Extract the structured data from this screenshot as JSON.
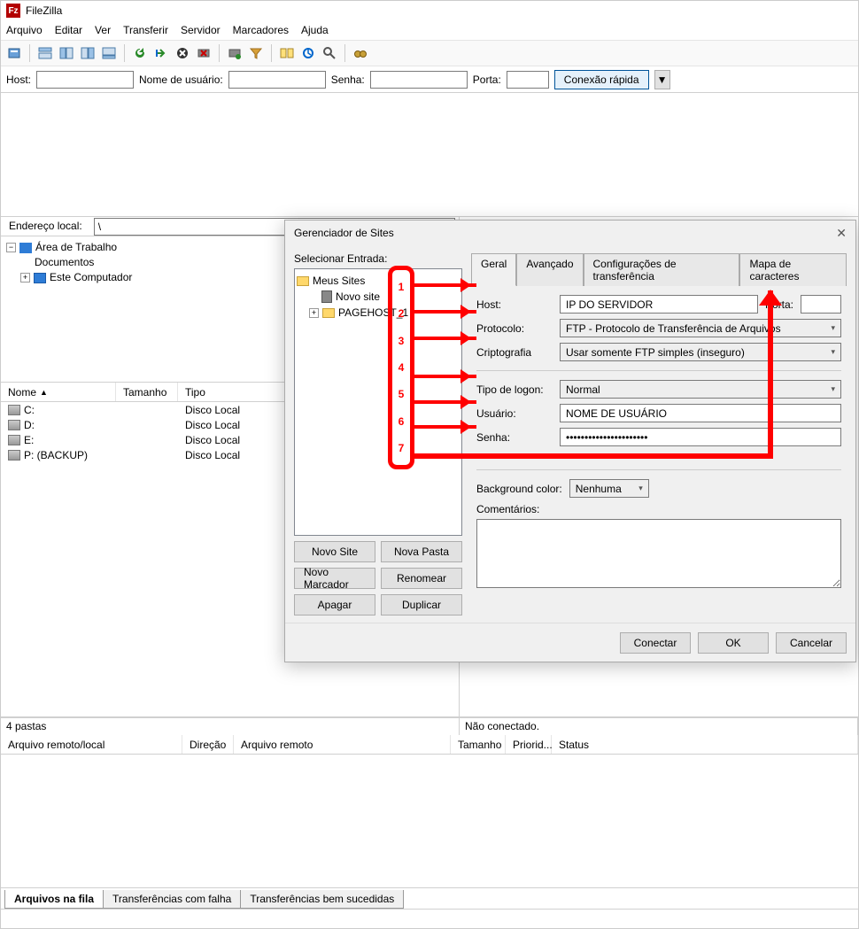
{
  "app": {
    "title": "FileZilla"
  },
  "menu": [
    "Arquivo",
    "Editar",
    "Ver",
    "Transferir",
    "Servidor",
    "Marcadores",
    "Ajuda"
  ],
  "quickbar": {
    "host_label": "Host:",
    "user_label": "Nome de usuário:",
    "pass_label": "Senha:",
    "port_label": "Porta:",
    "connect_label": "Conexão rápida"
  },
  "localaddr": {
    "label": "Endereço local:",
    "value": "\\"
  },
  "localtree": {
    "desktop": "Área de Trabalho",
    "documents": "Documentos",
    "computer": "Este Computador"
  },
  "localcols": {
    "name": "Nome",
    "size": "Tamanho",
    "type": "Tipo"
  },
  "drives": [
    {
      "name": "C:",
      "type": "Disco Local"
    },
    {
      "name": "D:",
      "type": "Disco Local"
    },
    {
      "name": "E:",
      "type": "Disco Local"
    },
    {
      "name": "P: (BACKUP)",
      "type": "Disco Local"
    }
  ],
  "status": {
    "left": "4 pastas",
    "right": "Não conectado."
  },
  "queuecols": [
    "Arquivo remoto/local",
    "Direção",
    "Arquivo remoto",
    "Tamanho",
    "Priorid...",
    "Status"
  ],
  "bottomtabs": [
    "Arquivos na fila",
    "Transferências com falha",
    "Transferências bem sucedidas"
  ],
  "dialog": {
    "title": "Gerenciador de Sites",
    "select_label": "Selecionar Entrada:",
    "tree": {
      "root": "Meus Sites",
      "novo": "Novo site",
      "page": "PAGEHOST_1"
    },
    "btns": {
      "novo_site": "Novo Site",
      "nova_pasta": "Nova Pasta",
      "novo_marcador": "Novo Marcador",
      "renomear": "Renomear",
      "apagar": "Apagar",
      "duplicar": "Duplicar"
    },
    "tabs": [
      "Geral",
      "Avançado",
      "Configurações de transferência",
      "Mapa de caracteres"
    ],
    "form": {
      "host_l": "Host:",
      "host_v": "IP DO SERVIDOR",
      "port_l": "Porta:",
      "proto_l": "Protocolo:",
      "proto_v": "FTP - Protocolo de Transferência de Arquivos",
      "cript_l": "Criptografia",
      "cript_v": "Usar somente FTP simples (inseguro)",
      "logon_l": "Tipo de logon:",
      "logon_v": "Normal",
      "user_l": "Usuário:",
      "user_v": "NOME DE USUÁRIO",
      "senha_l": "Senha:",
      "senha_v": "••••••••••••••••••••••",
      "bg_l": "Background color:",
      "bg_v": "Nenhuma",
      "comment_l": "Comentários:"
    },
    "footer": {
      "conectar": "Conectar",
      "ok": "OK",
      "cancelar": "Cancelar"
    }
  },
  "anno_nums": [
    "1",
    "2",
    "3",
    "4",
    "5",
    "6",
    "7"
  ]
}
